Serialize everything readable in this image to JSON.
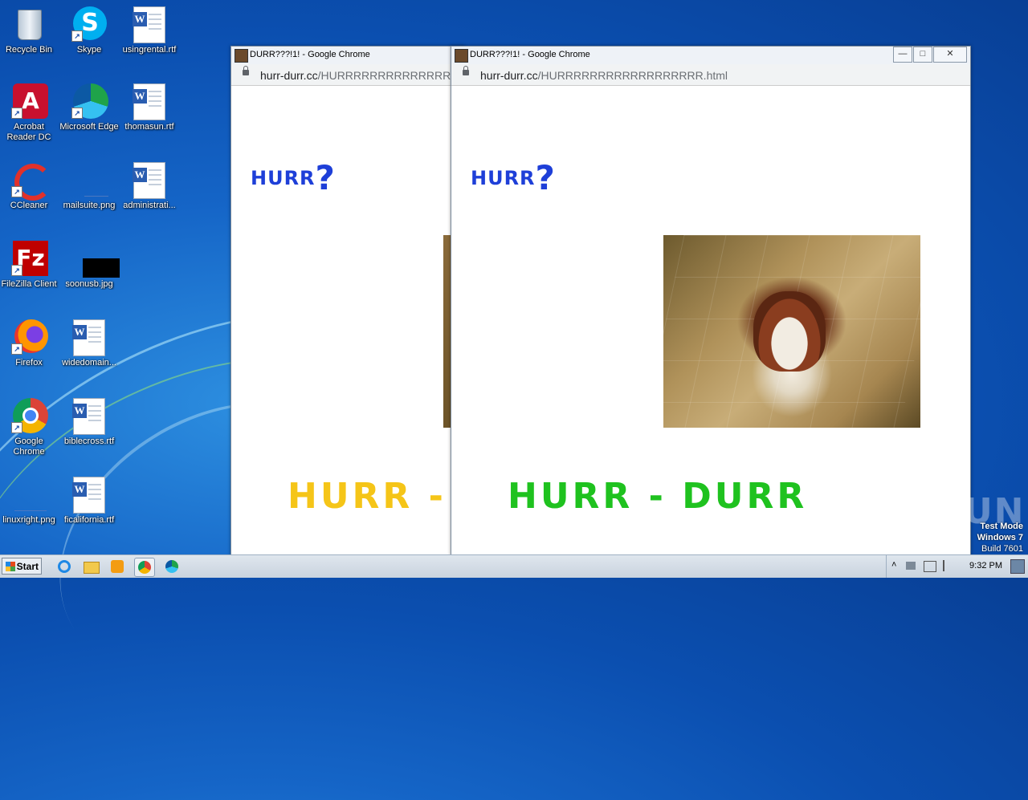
{
  "desktop": {
    "icons": [
      {
        "label": "Recycle Bin",
        "icon": "recycle-bin-icon"
      },
      {
        "label": "Skype",
        "icon": "skype-icon"
      },
      {
        "label": "usingrental.rtf",
        "icon": "word-document-icon"
      },
      {
        "label": "Acrobat Reader DC",
        "icon": "acrobat-icon"
      },
      {
        "label": "Microsoft Edge",
        "icon": "edge-icon"
      },
      {
        "label": "thomasun.rtf",
        "icon": "word-document-icon"
      },
      {
        "label": "CCleaner",
        "icon": "ccleaner-icon"
      },
      {
        "label": "mailsuite.png",
        "icon": "image-file-icon"
      },
      {
        "label": "administrati...",
        "icon": "word-document-icon"
      },
      {
        "label": "FileZilla Client",
        "icon": "filezilla-icon"
      },
      {
        "label": "soonusb.jpg",
        "icon": "image-file-icon"
      },
      {
        "label": "Firefox",
        "icon": "firefox-icon"
      },
      {
        "label": "widedomain...",
        "icon": "word-document-icon"
      },
      {
        "label": "Google Chrome",
        "icon": "chrome-icon"
      },
      {
        "label": "biblecross.rtf",
        "icon": "word-document-icon"
      },
      {
        "label": "linuxright.png",
        "icon": "image-file-icon"
      },
      {
        "label": "ficalifornia.rtf",
        "icon": "word-document-icon"
      }
    ]
  },
  "window_back": {
    "title": "DURR???!1! - Google Chrome",
    "url_domain": "hurr-durr.cc",
    "url_path": "/HURRRRRRRRRRRRRRRRRR",
    "heading": "HURR",
    "heading_mark": "?",
    "banner": "HURR - DURR",
    "banner_color": "#f5c518"
  },
  "window_front": {
    "title": "DURR???!1! - Google Chrome",
    "url_domain": "hurr-durr.cc",
    "url_path": "/HURRRRRRRRRRRRRRRRRR.html",
    "heading": "HURR",
    "heading_mark": "?",
    "banner": "HURR - DURR",
    "banner_color": "#1fc21f",
    "image": "bulldog-puppy-photo",
    "controls": {
      "minimize": "—",
      "maximize": "□",
      "close": "✕"
    }
  },
  "taskbar": {
    "start_label": "Start",
    "pinned": [
      "internet-explorer-icon",
      "explorer-folder-icon",
      "media-player-icon",
      "chrome-icon",
      "edge-icon"
    ],
    "clock": "9:32 PM"
  },
  "system": {
    "test_mode_line1": "Test Mode",
    "test_mode_line2": "Windows 7",
    "test_mode_line3": "Build 7601",
    "watermark": "ANY RUN"
  }
}
